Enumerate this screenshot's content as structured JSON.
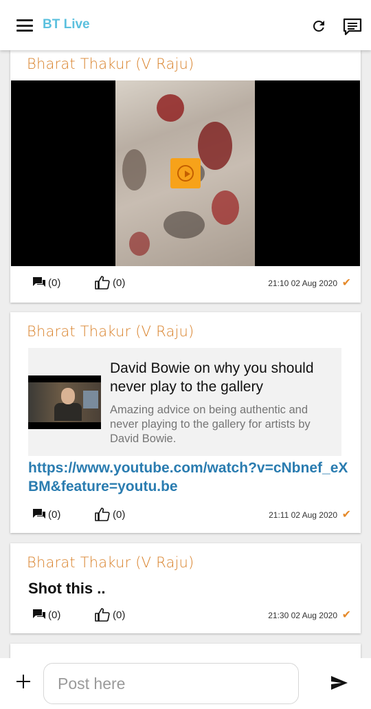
{
  "header": {
    "title": "BT Live",
    "title_color": "#5bc0de",
    "icons": [
      "menu-icon",
      "refresh-icon",
      "chat-bubble-icon"
    ]
  },
  "posts": [
    {
      "author": "Bharat Thakur (V Raju)",
      "type": "video",
      "comments": "(0)",
      "likes": "(0)",
      "timestamp": "21:10 02 Aug 2020"
    },
    {
      "author": "Bharat Thakur (V Raju)",
      "type": "link",
      "preview_title": "David Bowie on why you should never play to the gallery",
      "preview_description": "Amazing advice on being authentic and never playing to the gallery for artists by David Bowie.",
      "url": "https://www.youtube.com/watch?v=cNbnef_eXBM&feature=youtu.be",
      "comments": "(0)",
      "likes": "(0)",
      "timestamp": "21:11 02 Aug 2020"
    },
    {
      "author": "Bharat Thakur (V Raju)",
      "type": "text",
      "text": "Shot this ..",
      "comments": "(0)",
      "likes": "(0)",
      "timestamp": "21:30 02 Aug 2020"
    }
  ],
  "composer": {
    "placeholder": "Post here",
    "value": ""
  },
  "colors": {
    "author": "#d9822b",
    "link": "#2a7cb0",
    "check": "#e58a2b",
    "play_button": "#f7a21a"
  }
}
